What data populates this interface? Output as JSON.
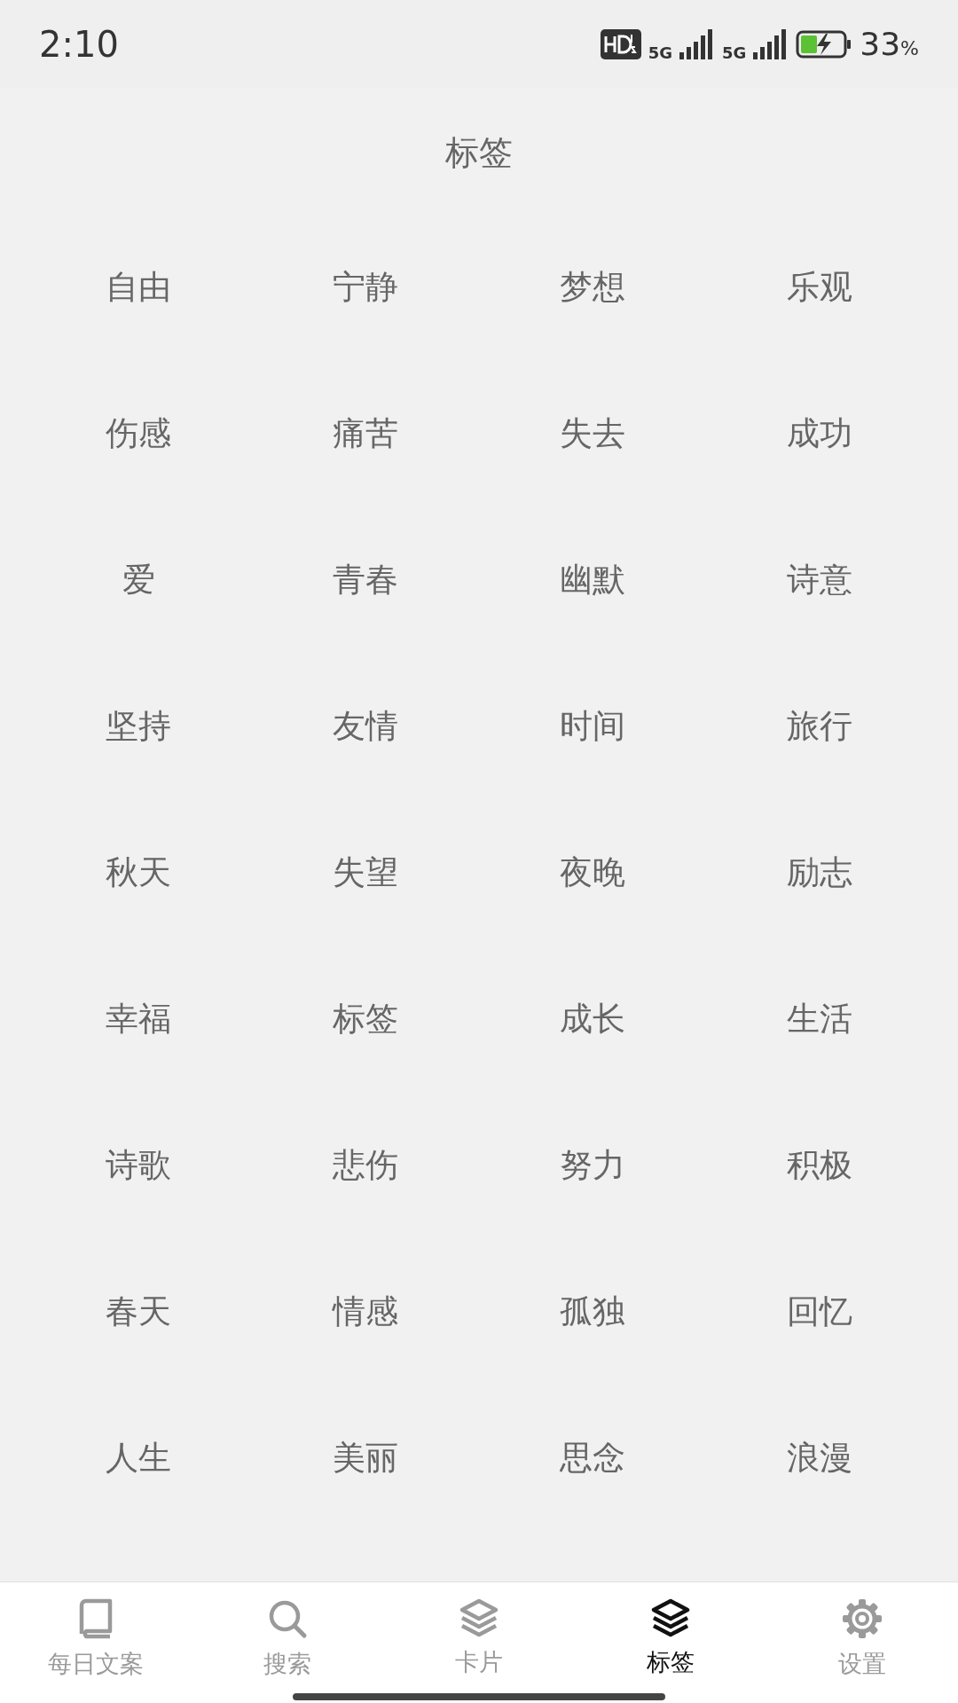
{
  "status_bar": {
    "time": "2:10",
    "network_1": "5G",
    "network_2": "5G",
    "battery": "33",
    "battery_unit": "%"
  },
  "title": "标签",
  "tags": [
    "自由",
    "宁静",
    "梦想",
    "乐观",
    "伤感",
    "痛苦",
    "失去",
    "成功",
    "爱",
    "青春",
    "幽默",
    "诗意",
    "坚持",
    "友情",
    "时间",
    "旅行",
    "秋天",
    "失望",
    "夜晚",
    "励志",
    "幸福",
    "标签",
    "成长",
    "生活",
    "诗歌",
    "悲伤",
    "努力",
    "积极",
    "春天",
    "情感",
    "孤独",
    "回忆",
    "人生",
    "美丽",
    "思念",
    "浪漫"
  ],
  "nav": [
    {
      "label": "每日文案",
      "kind": "book",
      "selected": false
    },
    {
      "label": "搜索",
      "kind": "search",
      "selected": false
    },
    {
      "label": "卡片",
      "kind": "layers",
      "selected": false
    },
    {
      "label": "标签",
      "kind": "layers",
      "selected": true
    },
    {
      "label": "设置",
      "kind": "gear",
      "selected": false
    }
  ]
}
